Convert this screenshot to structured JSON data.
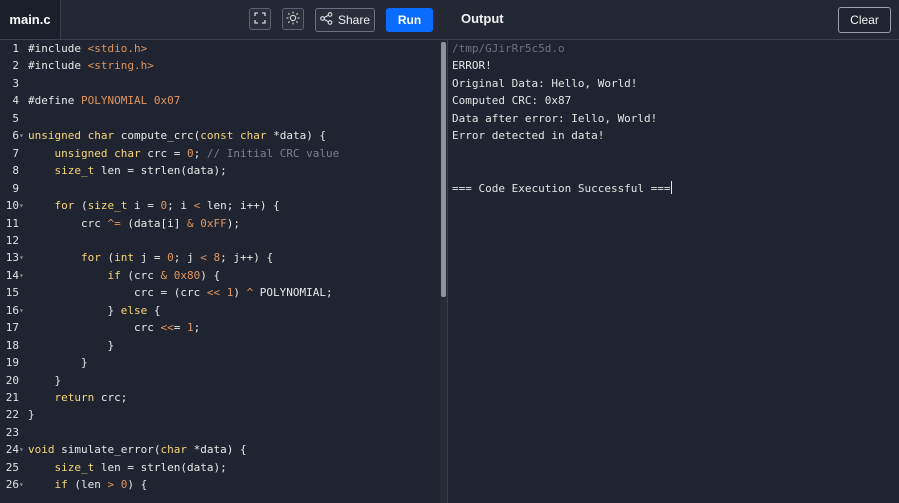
{
  "header": {
    "file_tab": "main.c",
    "share_label": "Share",
    "run_label": "Run",
    "output_title": "Output",
    "clear_label": "Clear",
    "fullscreen_icon": "fullscreen-icon",
    "theme_icon": "sun-icon",
    "share_icon": "share-icon"
  },
  "editor": {
    "lines": [
      {
        "n": "1",
        "fold": "",
        "code": "#include <stdio.h>"
      },
      {
        "n": "2",
        "fold": "",
        "code": "#include <string.h>"
      },
      {
        "n": "3",
        "fold": "",
        "code": ""
      },
      {
        "n": "4",
        "fold": "",
        "code": "#define POLYNOMIAL 0x07"
      },
      {
        "n": "5",
        "fold": "",
        "code": ""
      },
      {
        "n": "6",
        "fold": "▾",
        "code": "unsigned char compute_crc(const char *data) {"
      },
      {
        "n": "7",
        "fold": "",
        "code": "    unsigned char crc = 0; // Initial CRC value"
      },
      {
        "n": "8",
        "fold": "",
        "code": "    size_t len = strlen(data);"
      },
      {
        "n": "9",
        "fold": "",
        "code": ""
      },
      {
        "n": "10",
        "fold": "▾",
        "code": "    for (size_t i = 0; i < len; i++) {"
      },
      {
        "n": "11",
        "fold": "",
        "code": "        crc ^= (data[i] & 0xFF);"
      },
      {
        "n": "12",
        "fold": "",
        "code": ""
      },
      {
        "n": "13",
        "fold": "▾",
        "code": "        for (int j = 0; j < 8; j++) {"
      },
      {
        "n": "14",
        "fold": "▾",
        "code": "            if (crc & 0x80) {"
      },
      {
        "n": "15",
        "fold": "",
        "code": "                crc = (crc << 1) ^ POLYNOMIAL;"
      },
      {
        "n": "16",
        "fold": "▾",
        "code": "            } else {"
      },
      {
        "n": "17",
        "fold": "",
        "code": "                crc <<= 1;"
      },
      {
        "n": "18",
        "fold": "",
        "code": "            }"
      },
      {
        "n": "19",
        "fold": "",
        "code": "        }"
      },
      {
        "n": "20",
        "fold": "",
        "code": "    }"
      },
      {
        "n": "21",
        "fold": "",
        "code": "    return crc;"
      },
      {
        "n": "22",
        "fold": "",
        "code": "}"
      },
      {
        "n": "23",
        "fold": "",
        "code": ""
      },
      {
        "n": "24",
        "fold": "▾",
        "code": "void simulate_error(char *data) {"
      },
      {
        "n": "25",
        "fold": "",
        "code": "    size_t len = strlen(data);"
      },
      {
        "n": "26",
        "fold": "▾",
        "code": "    if (len > 0) {"
      }
    ]
  },
  "output": {
    "lines": [
      {
        "text": "/tmp/GJirRr5c5d.o",
        "path": true
      },
      {
        "text": "ERROR!",
        "path": false
      },
      {
        "text": "Original Data: Hello, World!",
        "path": false
      },
      {
        "text": "Computed CRC: 0x87",
        "path": false
      },
      {
        "text": "Data after error: Iello, World!",
        "path": false
      },
      {
        "text": "Error detected in data!",
        "path": false
      },
      {
        "text": "",
        "path": false
      },
      {
        "text": "",
        "path": false
      },
      {
        "text": "=== Code Execution Successful ===",
        "path": false
      }
    ]
  },
  "colors": {
    "run_button": "#0a6bff",
    "background": "#1f2430"
  }
}
